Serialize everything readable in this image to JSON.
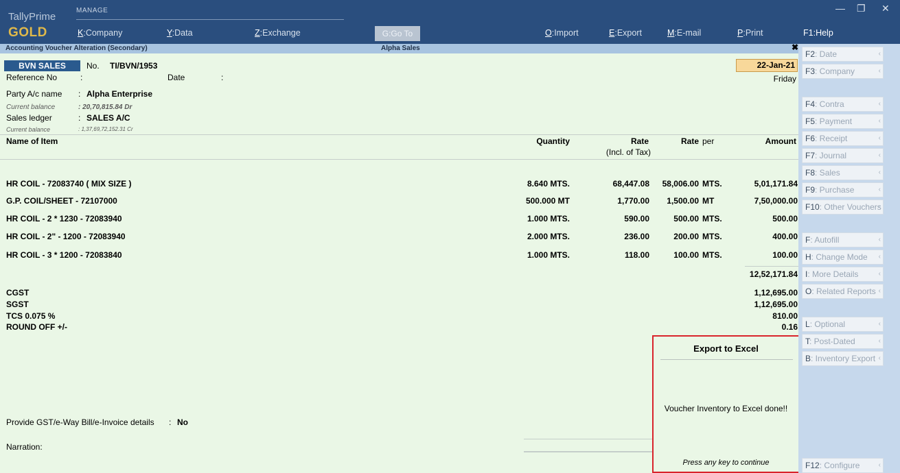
{
  "app": {
    "name": "TallyPrime",
    "edition": "GOLD",
    "manage_label": "MANAGE",
    "window_controls": {
      "minimize": "—",
      "restore": "❐",
      "close": "✕"
    }
  },
  "menu": {
    "company": {
      "key": "K",
      "label": ":Company"
    },
    "data": {
      "key": "Y",
      "label": ":Data"
    },
    "exchange": {
      "key": "Z",
      "label": ":Exchange"
    },
    "goto": "G:Go To",
    "import": {
      "key": "O",
      "label": ":Import"
    },
    "export": {
      "key": "E",
      "label": ":Export"
    },
    "email": {
      "key": "M",
      "label": ":E-mail"
    },
    "print": {
      "key": "P",
      "label": ":Print"
    },
    "help": {
      "key": "F1",
      "label": ":Help"
    }
  },
  "screen": {
    "title": "Accounting Voucher Alteration (Secondary)",
    "company": "Alpha Sales"
  },
  "voucher": {
    "type": "BVN SALES",
    "no_label": "No.",
    "number": "TI/BVN/1953",
    "ref_label": "Reference No",
    "ref_sep": ":",
    "date_label": "Date",
    "date_sep": ":",
    "date": "22-Jan-21",
    "day": "Friday",
    "party_label": "Party A/c name",
    "party_sep": ":",
    "party": "Alpha Enterprise",
    "party_balance_label": "Current balance",
    "party_balance": ": 20,70,815.84 Dr",
    "sales_ledger_label": "Sales ledger",
    "sales_ledger_sep": ":",
    "sales_ledger": "SALES A/C",
    "sales_balance_label": "Current balance",
    "sales_balance": ": 1,37,69,72,152.31 Cr"
  },
  "columns": {
    "item": "Name of Item",
    "quantity": "Quantity",
    "rate_incl": "Rate",
    "rate_incl_sub": "(Incl. of Tax)",
    "rate": "Rate",
    "per": "per",
    "amount": "Amount"
  },
  "items": [
    {
      "name": "HR COIL - 72083740  ( MIX SIZE )",
      "qty": "8.640 MTS.",
      "rate_incl": "68,447.08",
      "rate": "58,006.00",
      "per": "MTS.",
      "amount": "5,01,171.84"
    },
    {
      "name": "G.P. COIL/SHEET - 72107000",
      "qty": "500.000 MT",
      "rate_incl": "1,770.00",
      "rate": "1,500.00",
      "per": "MT",
      "amount": "7,50,000.00"
    },
    {
      "name": "HR COIL - 2 * 1230 - 72083940",
      "qty": "1.000 MTS.",
      "rate_incl": "590.00",
      "rate": "500.00",
      "per": "MTS.",
      "amount": "500.00"
    },
    {
      "name": "HR COIL -  2\" - 1200 - 72083940",
      "qty": "2.000 MTS.",
      "rate_incl": "236.00",
      "rate": "200.00",
      "per": "MTS.",
      "amount": "400.00"
    },
    {
      "name": "HR COIL - 3 * 1200 - 72083840",
      "qty": "1.000 MTS.",
      "rate_incl": "118.00",
      "rate": "100.00",
      "per": "MTS.",
      "amount": "100.00"
    }
  ],
  "subtotal": "12,52,171.84",
  "ledgers": [
    {
      "name": "CGST",
      "amount": "1,12,695.00"
    },
    {
      "name": "SGST",
      "amount": "1,12,695.00"
    },
    {
      "name": "TCS 0.075 %",
      "amount": "810.00"
    },
    {
      "name": "ROUND OFF +/-",
      "amount": "0.16"
    }
  ],
  "gst": {
    "label": "Provide GST/e-Way Bill/e-Invoice details",
    "sep": ":",
    "value": "No"
  },
  "narration_label": "Narration:",
  "popup": {
    "title": "Export to Excel",
    "message": "Voucher Inventory to Excel done!!",
    "footer": "Press any key to continue"
  },
  "right_panel": {
    "date": {
      "key": "F2",
      "label": ": Date"
    },
    "company": {
      "key": "F3",
      "label": ": Company"
    },
    "contra": {
      "key": "F4",
      "label": ": Contra"
    },
    "payment": {
      "key": "F5",
      "label": ": Payment"
    },
    "receipt": {
      "key": "F6",
      "label": ": Receipt"
    },
    "journal": {
      "key": "F7",
      "label": ": Journal"
    },
    "sales": {
      "key": "F8",
      "label": ": Sales"
    },
    "purchase": {
      "key": "F9",
      "label": ": Purchase"
    },
    "other": {
      "key": "F10",
      "label": ": Other Vouchers"
    },
    "autofill": {
      "key": "F",
      "label": ": Autofill"
    },
    "change_mode": {
      "key": "H",
      "label": ": Change Mode"
    },
    "more_details": {
      "key": "I",
      "label": ": More Details"
    },
    "related_reports": {
      "key": "O",
      "label": ": Related Reports"
    },
    "optional": {
      "key": "L",
      "label": ": Optional"
    },
    "post_dated": {
      "key": "T",
      "label": ": Post-Dated"
    },
    "inventory_export": {
      "key": "B",
      "label": ": Inventory Export"
    },
    "configure": {
      "key": "F12",
      "label": ": Configure"
    },
    "arrow": "‹"
  }
}
